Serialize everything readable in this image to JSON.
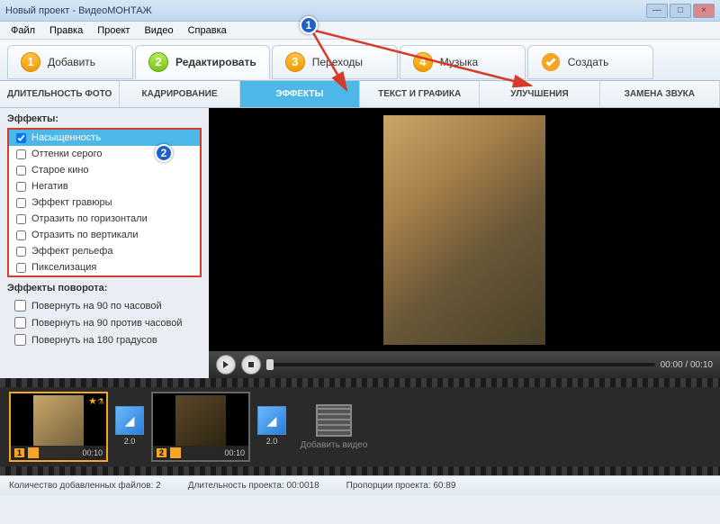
{
  "window": {
    "title": "Новый проект - ВидеоМОНТАЖ"
  },
  "menu": {
    "file": "Файл",
    "edit": "Правка",
    "project": "Проект",
    "video": "Видео",
    "help": "Справка"
  },
  "tabs": {
    "add": {
      "num": "1",
      "label": "Добавить"
    },
    "edit": {
      "num": "2",
      "label": "Редактировать"
    },
    "trans": {
      "num": "3",
      "label": "Переходы"
    },
    "music": {
      "num": "4",
      "label": "Музыка"
    },
    "create": {
      "label": "Создать"
    }
  },
  "subtabs": {
    "duration": "ДЛИТЕЛЬНОСТЬ ФОТО",
    "crop": "КАДРИРОВАНИЕ",
    "effects": "ЭФФЕКТЫ",
    "text": "ТЕКСТ И ГРАФИКА",
    "enhance": "УЛУЧШЕНИЯ",
    "audio": "ЗАМЕНА ЗВУКА"
  },
  "sidebar": {
    "effects_title": "Эффекты:",
    "effects": [
      "Насыщенность",
      "Оттенки серого",
      "Старое кино",
      "Негатив",
      "Эффект гравюры",
      "Отразить по горизонтали",
      "Отразить по вертикали",
      "Эффект рельефа",
      "Пикселизация"
    ],
    "rotation_title": "Эффекты поворота:",
    "rotations": [
      "Повернуть на 90 по часовой",
      "Повернуть на 90 против часовой",
      "Повернуть на 180 градусов"
    ]
  },
  "player": {
    "time": "00:00 / 00:10"
  },
  "timeline": {
    "clip1": {
      "num": "1",
      "dur": "00:10"
    },
    "trans1": "2.0",
    "clip2": {
      "num": "2",
      "dur": "00:10"
    },
    "trans2": "2.0",
    "add": "Добавить видео"
  },
  "status": {
    "files": "Количество добавленных файлов: 2",
    "duration": "Длительность проекта:   00:0018",
    "aspect": "Пропорции проекта:   60:89"
  },
  "annotations": {
    "a1": "1",
    "a2": "2"
  }
}
